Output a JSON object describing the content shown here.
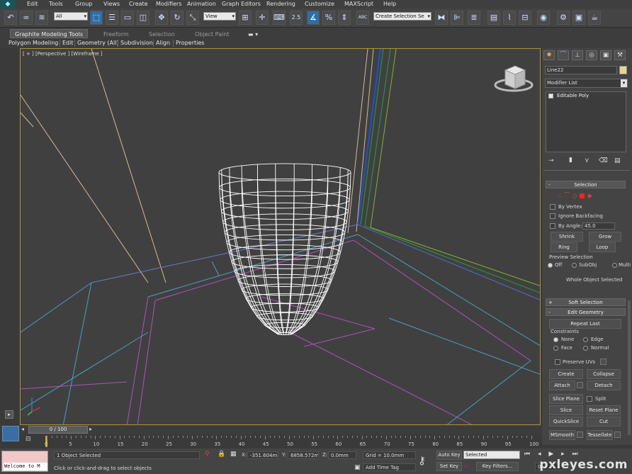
{
  "menu": [
    "Edit",
    "Tools",
    "Group",
    "Views",
    "Create",
    "Modifiers",
    "Animation",
    "Graph Editors",
    "Rendering",
    "Customize",
    "MAXScript",
    "Help"
  ],
  "toolbar": {
    "filter_value": "All",
    "refcoord_value": "View",
    "snap_label": "2.5",
    "angle_snap_label": "ABC",
    "selection_set_value": "Create Selection Se"
  },
  "ribbon": {
    "tabs": [
      "Graphite Modeling Tools",
      "Freeform",
      "Selection",
      "Object Paint"
    ],
    "subtabs": [
      "Polygon Modeling",
      "Edit",
      "Geometry (All)",
      "Subdivision",
      "Align",
      "Properties"
    ]
  },
  "viewport": {
    "label": "[ + ] [Perspective ] [Wireframe ]"
  },
  "command_panel": {
    "object_name": "Line22",
    "modifier_list": "Modifier List",
    "stack_item": "Editable Poly",
    "selection_title": "Selection",
    "by_vertex": "By Vertex",
    "ignore_backfacing": "Ignore Backfacing",
    "by_angle": "By Angle:",
    "angle_value": "45.0",
    "shrink": "Shrink",
    "grow": "Grow",
    "ring": "Ring",
    "loop": "Loop",
    "preview_selection": "Preview Selection",
    "preview_off": "Off",
    "preview_subobj": "SubObj",
    "preview_multi": "Multi",
    "whole_object": "Whole Object Selected",
    "soft_selection": "Soft Selection",
    "edit_geometry": "Edit Geometry",
    "repeat_last": "Repeat Last",
    "constraints": "Constraints",
    "c_none": "None",
    "c_edge": "Edge",
    "c_face": "Face",
    "c_normal": "Normal",
    "preserve_uvs": "Preserve UVs",
    "create": "Create",
    "collapse": "Collapse",
    "attach": "Attach",
    "detach": "Detach",
    "slice_plane": "Slice Plane",
    "split": "Split",
    "slice": "Slice",
    "reset_plane": "Reset Plane",
    "quickslice": "QuickSlice",
    "cut": "Cut",
    "msmooth": "MSmooth",
    "tessellate": "Tessellate"
  },
  "timeline": {
    "frame_label": "0 / 100",
    "ticks": [
      "0",
      "5",
      "10",
      "15",
      "20",
      "25",
      "30",
      "35",
      "40",
      "45",
      "50",
      "55",
      "60",
      "65",
      "70",
      "75",
      "80",
      "85",
      "90",
      "95",
      "100"
    ]
  },
  "status": {
    "listener": "Welcome to M",
    "objects_selected": "1 Object Selected",
    "prompt": "Click or click-and-drag to select objects",
    "x_label": "X:",
    "x_value": "-351.604m",
    "y_label": "Y:",
    "y_value": "6858.572m",
    "z_label": "Z:",
    "z_value": "0.0mm",
    "grid": "Grid = 10.0mm",
    "add_time_tag": "Add Time Tag",
    "auto_key": "Auto Key",
    "selected": "Selected",
    "set_key": "Set Key",
    "key_filters": "Key Filters...",
    "frame": "0"
  },
  "watermark": "pxleyes.com",
  "colors": {
    "viewport_border": "#b3912f",
    "selected_mesh": "#ffffff",
    "accent_blue": "#2e6ea8"
  }
}
